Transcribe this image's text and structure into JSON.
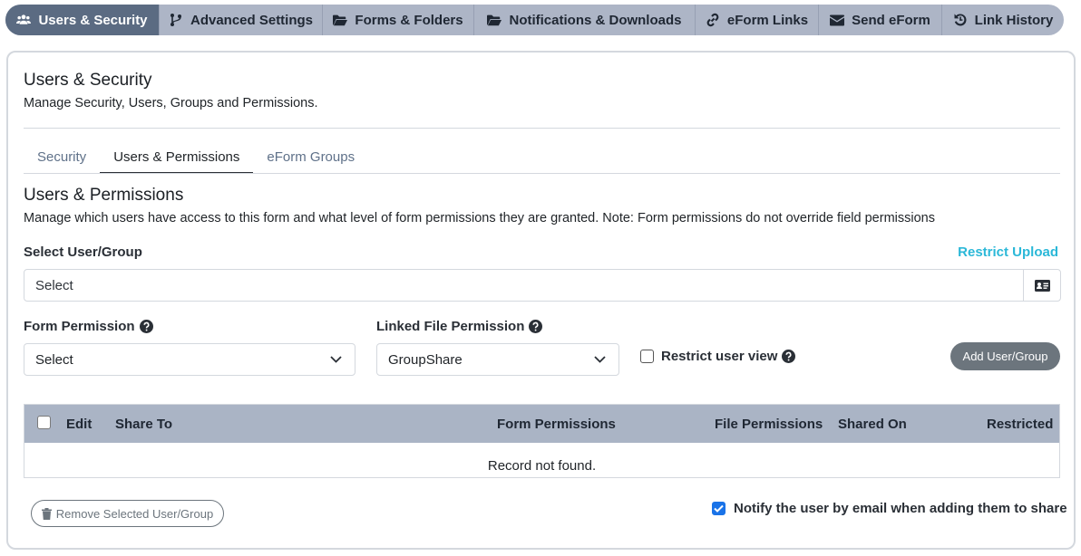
{
  "top_tabs": [
    {
      "label": "Users & Security",
      "icon": "users-icon",
      "active": true
    },
    {
      "label": "Advanced Settings",
      "icon": "branch-icon",
      "active": false
    },
    {
      "label": "Forms & Folders",
      "icon": "folder-open-icon",
      "active": false
    },
    {
      "label": "Notifications & Downloads",
      "icon": "folder-open-icon",
      "active": false
    },
    {
      "label": "eForm Links",
      "icon": "link-icon",
      "active": false
    },
    {
      "label": "Send eForm",
      "icon": "envelope-icon",
      "active": false
    },
    {
      "label": "Link History",
      "icon": "history-icon",
      "active": false
    }
  ],
  "page": {
    "title": "Users & Security",
    "subtitle": "Manage Security, Users, Groups and Permissions."
  },
  "sub_tabs": [
    {
      "label": "Security",
      "active": false
    },
    {
      "label": "Users & Permissions",
      "active": true
    },
    {
      "label": "eForm Groups",
      "active": false
    }
  ],
  "section": {
    "title": "Users & Permissions",
    "description": "Manage which users have access to this form and what level of form permissions they are granted. Note: Form permissions do not override field permissions"
  },
  "user_group": {
    "label": "Select User/Group",
    "placeholder": "Select",
    "restrict_upload_link": "Restrict Upload"
  },
  "form_permission": {
    "label": "Form Permission",
    "value": "Select"
  },
  "linked_file_permission": {
    "label": "Linked File Permission",
    "value": "GroupShare"
  },
  "restrict_user_view": {
    "label": "Restrict user view",
    "checked": false
  },
  "add_button": "Add User/Group",
  "table": {
    "columns": [
      "Edit",
      "Share To",
      "Form Permissions",
      "File Permissions",
      "Shared On",
      "Restricted"
    ],
    "empty_message": "Record not found."
  },
  "remove_button": "Remove Selected User/Group",
  "notify": {
    "label": "Notify the user by email when adding them to share",
    "checked": true
  },
  "colors": {
    "tab_bar": "#adb5c6",
    "tab_active": "#5b6b82",
    "link_accent": "#2bb8d8",
    "table_header": "#aab4c5",
    "button_gray": "#6c757d",
    "checkbox_checked": "#1a73e8"
  }
}
